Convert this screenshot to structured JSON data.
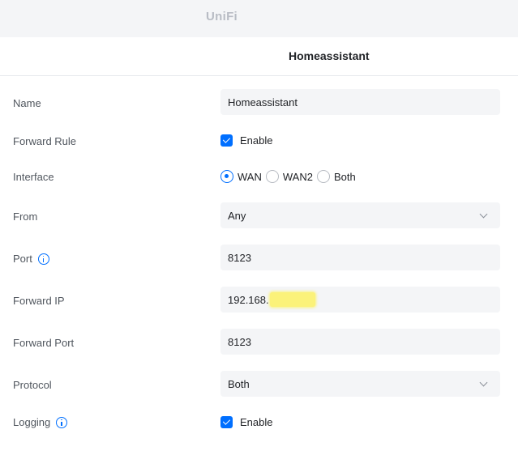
{
  "app": {
    "logo": "UniFi"
  },
  "header": {
    "title": "Homeassistant"
  },
  "form": {
    "name": {
      "label": "Name",
      "value": "Homeassistant"
    },
    "forward_rule": {
      "label": "Forward Rule",
      "checkbox_label": "Enable",
      "checked": true
    },
    "interface": {
      "label": "Interface",
      "options": [
        "WAN",
        "WAN2",
        "Both"
      ],
      "selected": "WAN"
    },
    "from": {
      "label": "From",
      "value": "Any"
    },
    "port": {
      "label": "Port",
      "value": "8123"
    },
    "forward_ip": {
      "label": "Forward IP",
      "value_prefix": "192.168."
    },
    "forward_port": {
      "label": "Forward Port",
      "value": "8123"
    },
    "protocol": {
      "label": "Protocol",
      "value": "Both"
    },
    "logging": {
      "label": "Logging",
      "checkbox_label": "Enable",
      "checked": true
    }
  },
  "colors": {
    "accent": "#006fff",
    "field_bg": "#f4f5f7",
    "highlight": "#fbf27a"
  }
}
